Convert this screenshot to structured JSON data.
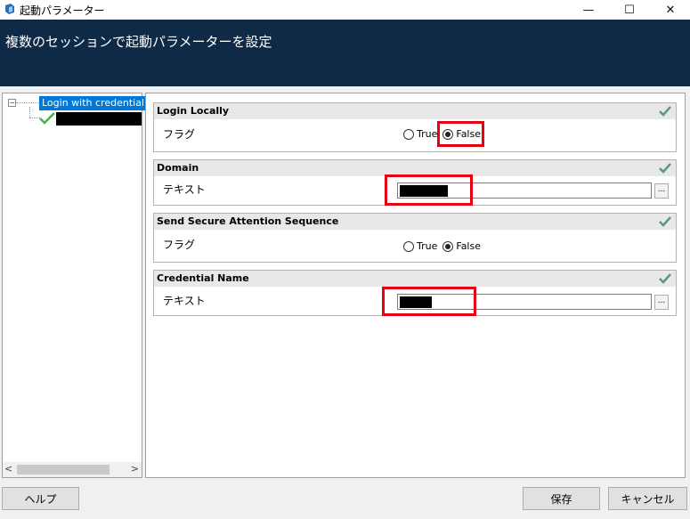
{
  "window": {
    "title": "起動パラメーター",
    "minimize_glyph": "—",
    "maximize_glyph": "☐",
    "close_glyph": "✕"
  },
  "header": {
    "title": "複数のセッションで起動パラメーターを設定"
  },
  "tree": {
    "selected_label": "Login with credential",
    "expander_glyph": "−"
  },
  "scroll": {
    "left_glyph": "<",
    "right_glyph": ">"
  },
  "params": [
    {
      "title": "Login Locally",
      "label": "フラグ",
      "type": "radio",
      "options": [
        "True",
        "False"
      ],
      "selected": "False"
    },
    {
      "title": "Domain",
      "label": "テキスト",
      "type": "text",
      "value_redacted": true
    },
    {
      "title": "Send Secure Attention Sequence",
      "label": "フラグ",
      "type": "radio",
      "options": [
        "True",
        "False"
      ],
      "selected": "False"
    },
    {
      "title": "Credential Name",
      "label": "テキスト",
      "type": "text",
      "value_redacted": true
    }
  ],
  "browse_label": "...",
  "buttons": {
    "help": "ヘルプ",
    "save": "保存",
    "cancel": "キャンセル"
  },
  "colors": {
    "header": "#0f2a47",
    "selection": "#0078d7",
    "highlight": "#e60012",
    "check": "#5a9a7a"
  },
  "icons": {
    "check": "check-mark-icon",
    "app": "app-icon"
  }
}
